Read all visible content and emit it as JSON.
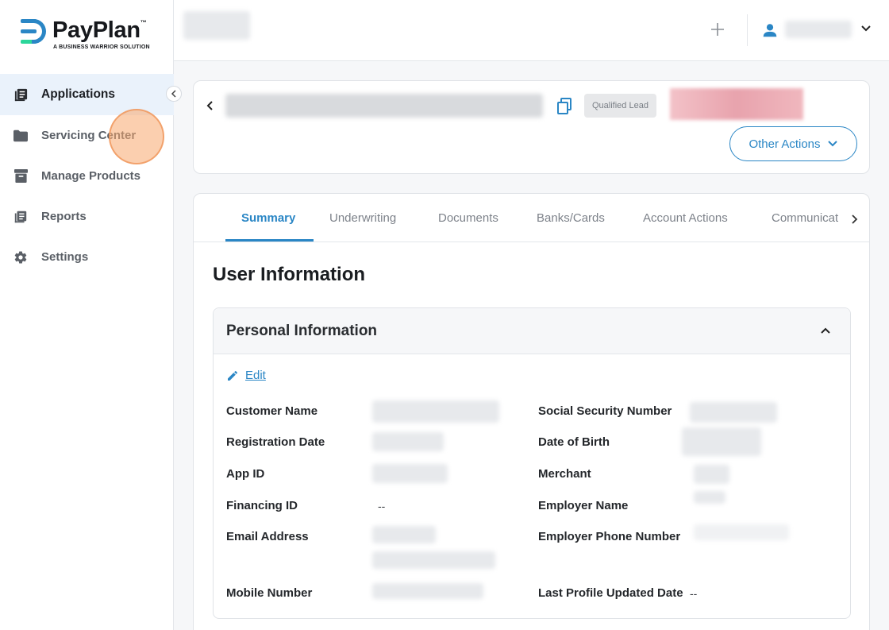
{
  "brand": {
    "name": "PayPlan",
    "trademark": "™",
    "tagline": "A BUSINESS WARRIOR SOLUTION",
    "colors": {
      "blue": "#2a86c5",
      "green": "#2bd69a"
    }
  },
  "sidebar": {
    "collapse_icon": "chevron-left-icon",
    "items": [
      {
        "label": "Applications",
        "icon": "applications-icon",
        "active": true
      },
      {
        "label": "Servicing Center",
        "icon": "folder-icon",
        "active": false
      },
      {
        "label": "Manage Products",
        "icon": "archive-icon",
        "active": false
      },
      {
        "label": "Reports",
        "icon": "reports-icon",
        "active": false
      },
      {
        "label": "Settings",
        "icon": "gear-icon",
        "active": false
      }
    ]
  },
  "topbar": {
    "add_icon": "plus",
    "user_icon": "user-icon",
    "menu_icon": "chevron-down-icon"
  },
  "header": {
    "status_badge": "Qualified Lead",
    "other_actions_label": "Other Actions"
  },
  "tabs": {
    "items": [
      "Summary",
      "Underwriting",
      "Documents",
      "Banks/Cards",
      "Account Actions",
      "Communications"
    ],
    "active": "Summary"
  },
  "main": {
    "section_title": "User Information",
    "panel_title": "Personal Information",
    "edit_label": "Edit",
    "fields_left": [
      {
        "label": "Customer Name",
        "value": ""
      },
      {
        "label": "Registration Date",
        "value": ""
      },
      {
        "label": "App ID",
        "value": ""
      },
      {
        "label": "Financing ID",
        "value": "--"
      },
      {
        "label": "Email Address",
        "value": ""
      },
      {
        "label": "Mobile Number",
        "value": ""
      }
    ],
    "fields_right": [
      {
        "label": "Social Security Number",
        "value": ""
      },
      {
        "label": "Date of Birth",
        "value": ""
      },
      {
        "label": "Merchant",
        "value": ""
      },
      {
        "label": "Employer Name",
        "value": ""
      },
      {
        "label": "Employer Phone Number",
        "value": ""
      },
      {
        "label": "Last Profile Updated Date",
        "value": "--"
      }
    ]
  }
}
